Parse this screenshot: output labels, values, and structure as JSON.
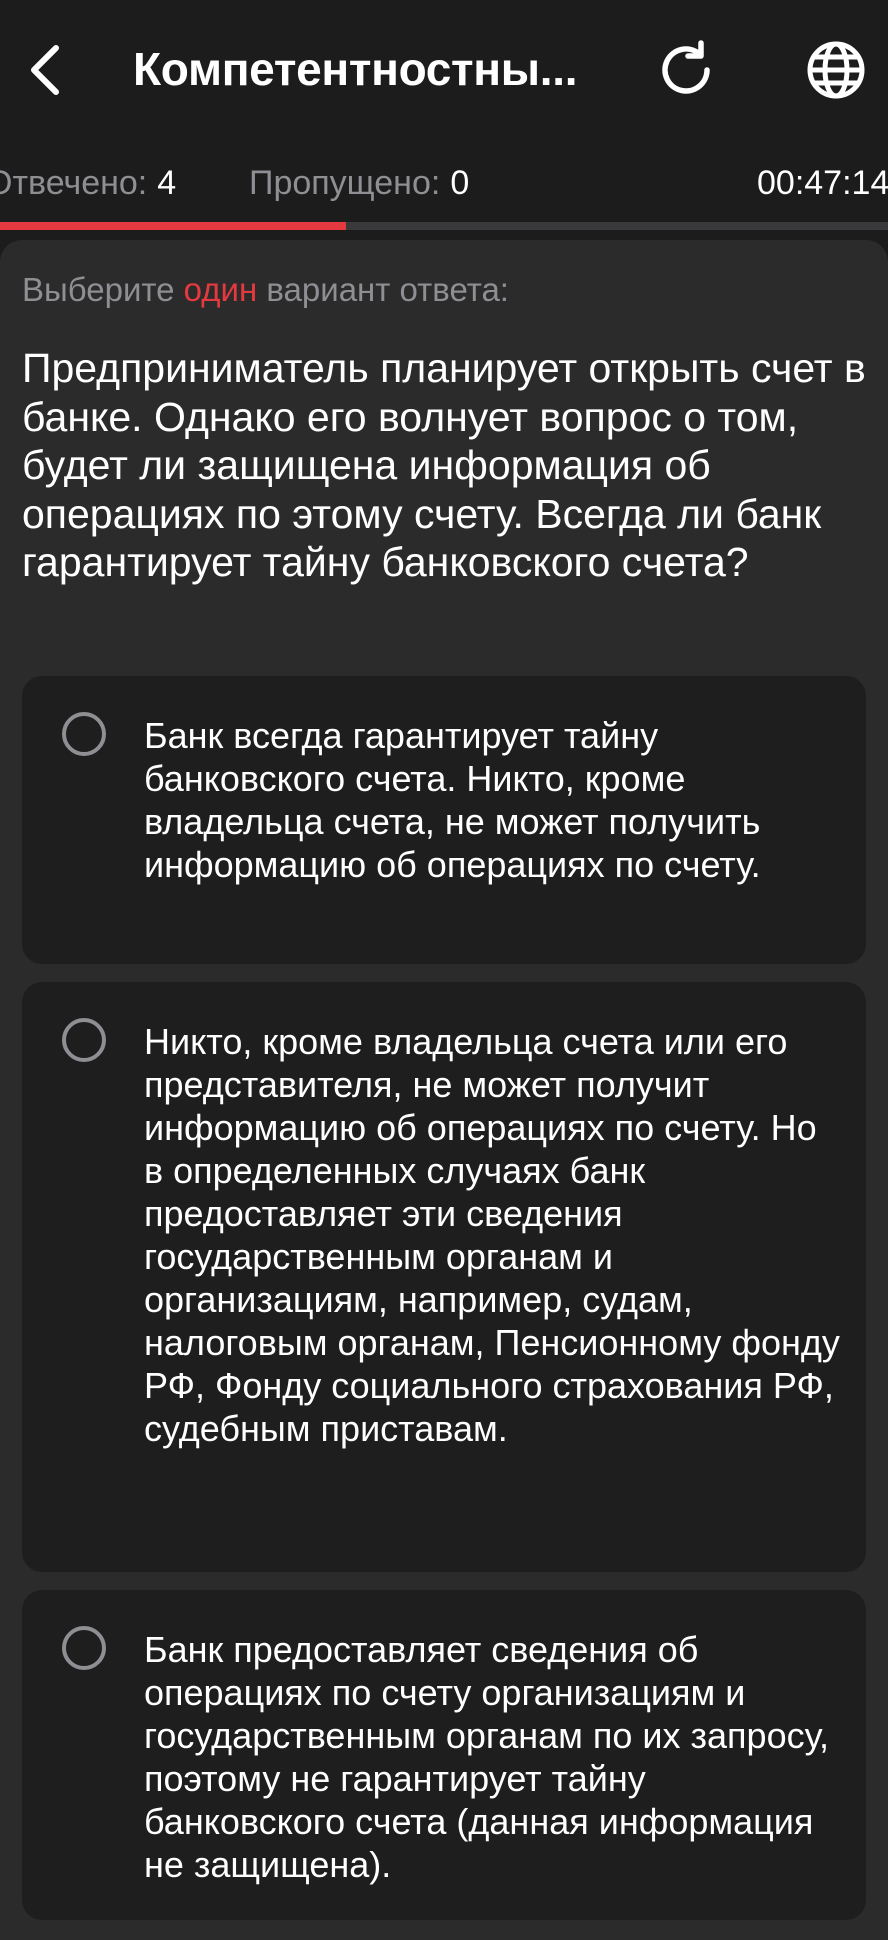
{
  "header": {
    "title": "Компетентностны...",
    "back_icon": "chevron-left-icon",
    "refresh_icon": "refresh-icon",
    "language_icon": "globe-icon"
  },
  "stats": {
    "answered_label": "Отвечено:",
    "answered_value": "4",
    "skipped_label": "Пропущено:",
    "skipped_value": "0",
    "timer": "00:47:14"
  },
  "progress": {
    "fraction": 0.39,
    "color": "#e53940"
  },
  "instruction": {
    "prefix": "Выберите",
    "accent": "один",
    "suffix": "вариант ответа:"
  },
  "question": {
    "text": "Предприниматель планирует открыть счет в банке. Однако его волнует вопрос о том, будет ли защищена информация об операциях по этому счету. Всегда ли банк гарантирует тайну банковского счета?"
  },
  "options": [
    {
      "text": "Банк всегда гарантирует тайну банковского счета. Никто, кроме владельца счета, не может получить информацию об операциях по счету.",
      "selected": false
    },
    {
      "text": "Никто, кроме владельца счета или его представителя, не может получит информацию об операциях по счету. Но в определенных случаях банк предоставляет эти сведения государственным органам и организациям, например, судам, налоговым органам, Пенсионному фонду РФ, Фонду социального страхования РФ, судебным приставам.",
      "selected": false
    },
    {
      "text": "Банк предоставляет сведения об операциях по счету организациям и государственным органам по их запросу, поэтому не гарантирует тайну банковского счета (данная информация не защищена).",
      "selected": false
    }
  ],
  "colors": {
    "background": "#1c1c1d",
    "card": "#2b2b2c",
    "option": "#1e1e1f",
    "accent": "#e53940",
    "muted": "#8e8e93"
  }
}
